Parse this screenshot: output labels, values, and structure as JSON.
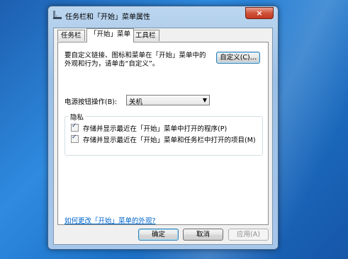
{
  "window": {
    "title": "任务栏和「开始」菜单属性",
    "close_glyph": "×"
  },
  "tabs": [
    {
      "label": "任务栏",
      "active": false
    },
    {
      "label": "「开始」菜单",
      "active": true
    },
    {
      "label": "工具栏",
      "active": false
    }
  ],
  "panel": {
    "description_line1": "要自定义链接、图标和菜单在「开始」菜单中的",
    "description_line2": "外观和行为，请单击“自定义”。",
    "customize_button": "自定义(C)...",
    "power_label": "电源按钮操作(B):",
    "power_value": "关机",
    "privacy": {
      "title": "隐私",
      "items": [
        {
          "label": "存储并显示最近在「开始」菜单中打开的程序(P)",
          "checked": true
        },
        {
          "label": "存储并显示最近在「开始」菜单和任务栏中打开的项目(M)",
          "checked": true
        }
      ]
    },
    "link": "如何更改「开始」菜单的外观?"
  },
  "footer": {
    "ok": "确定",
    "cancel": "取消",
    "apply": "应用(A)"
  }
}
